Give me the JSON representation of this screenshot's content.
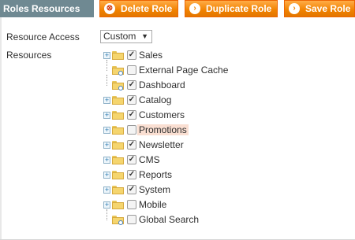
{
  "header": {
    "section_title": "Roles Resources",
    "buttons": {
      "delete": "Delete Role",
      "duplicate": "Duplicate Role",
      "save": "Save Role"
    }
  },
  "form": {
    "resource_access_label": "Resource Access",
    "resource_access_value": "Custom",
    "resources_label": "Resources"
  },
  "resources": [
    {
      "label": "Sales",
      "checked": true,
      "expandable": true
    },
    {
      "label": "External Page Cache",
      "checked": false,
      "expandable": false
    },
    {
      "label": "Dashboard",
      "checked": true,
      "expandable": false
    },
    {
      "label": "Catalog",
      "checked": true,
      "expandable": true
    },
    {
      "label": "Customers",
      "checked": true,
      "expandable": true
    },
    {
      "label": "Promotions",
      "checked": false,
      "expandable": true,
      "highlighted": true
    },
    {
      "label": "Newsletter",
      "checked": true,
      "expandable": true
    },
    {
      "label": "CMS",
      "checked": true,
      "expandable": true
    },
    {
      "label": "Reports",
      "checked": true,
      "expandable": true
    },
    {
      "label": "System",
      "checked": true,
      "expandable": true
    },
    {
      "label": "Mobile",
      "checked": false,
      "expandable": true
    },
    {
      "label": "Global Search",
      "checked": false,
      "expandable": false
    }
  ],
  "colors": {
    "section_title_bg": "#6f8992",
    "button_bg": "#f18200",
    "highlight": "#fadfd2"
  }
}
